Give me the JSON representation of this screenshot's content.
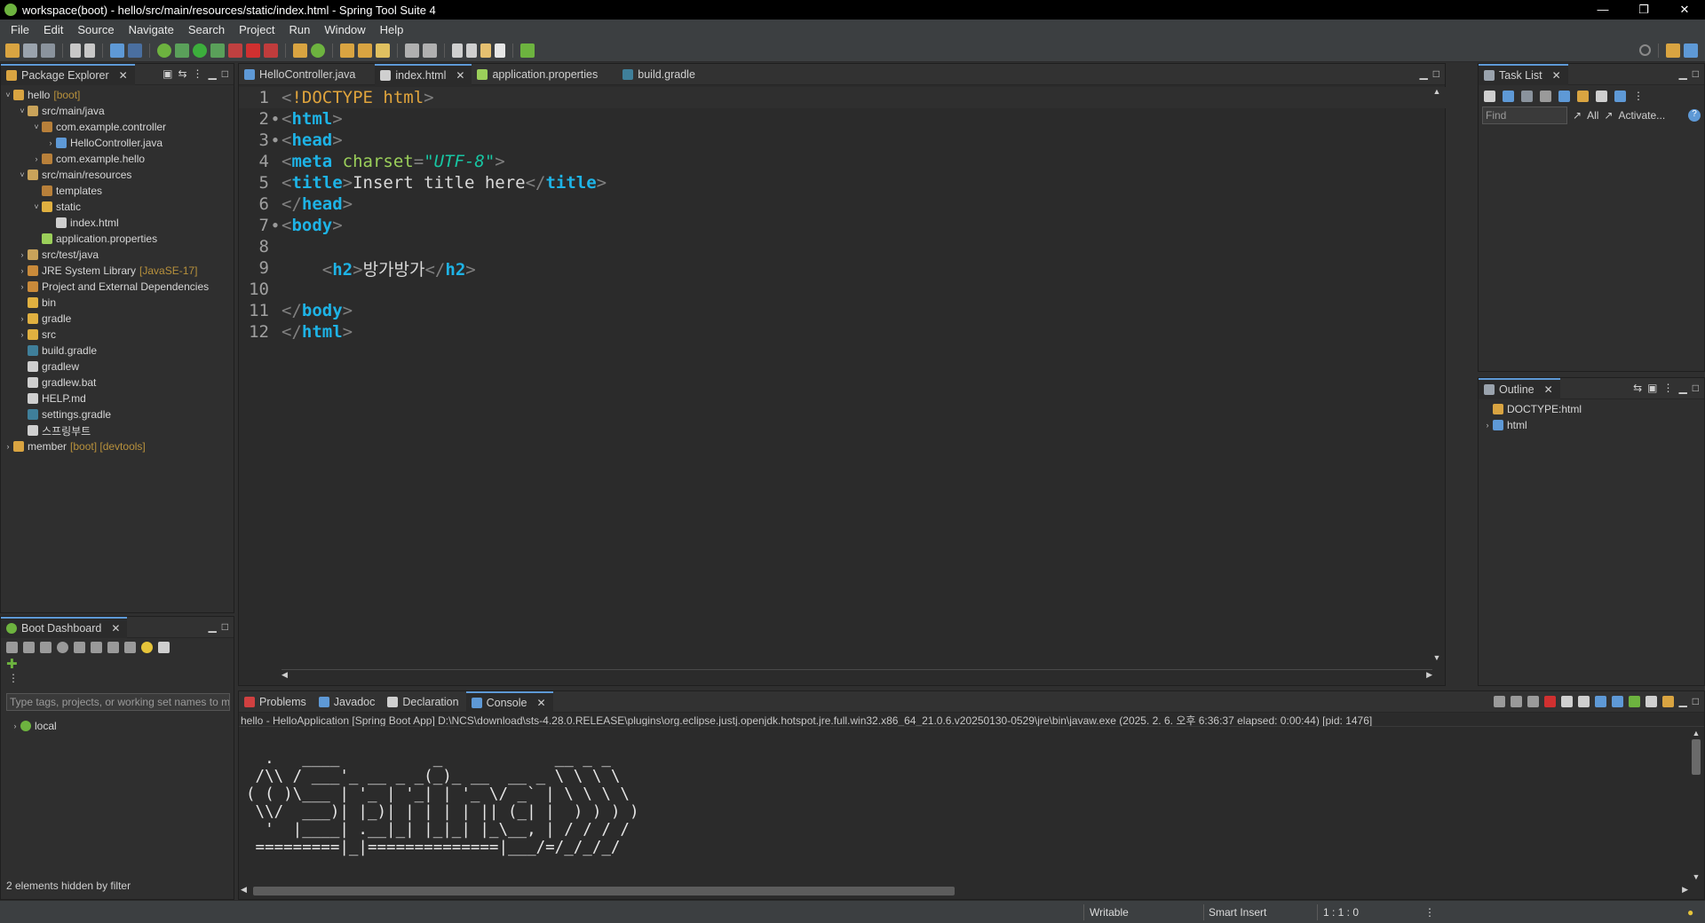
{
  "window": {
    "title": "workspace(boot) - hello/src/main/resources/static/index.html - Spring Tool Suite 4"
  },
  "menu": [
    "File",
    "Edit",
    "Source",
    "Navigate",
    "Search",
    "Project",
    "Run",
    "Window",
    "Help"
  ],
  "package_explorer": {
    "tab_label": "Package Explorer",
    "tree": [
      {
        "label": "hello",
        "deco": "[boot]",
        "arrow": "˅",
        "icon": "project-icon",
        "indent": 0
      },
      {
        "label": "src/main/java",
        "arrow": "˅",
        "icon": "source-folder-icon",
        "indent": 1
      },
      {
        "label": "com.example.controller",
        "arrow": "˅",
        "icon": "package-icon",
        "indent": 2
      },
      {
        "label": "HelloController.java",
        "arrow": "›",
        "icon": "java-file-icon",
        "indent": 3
      },
      {
        "label": "com.example.hello",
        "arrow": "›",
        "icon": "package-icon",
        "indent": 2
      },
      {
        "label": "src/main/resources",
        "arrow": "˅",
        "icon": "source-folder-icon",
        "indent": 1
      },
      {
        "label": "templates",
        "arrow": "",
        "icon": "package-icon",
        "indent": 2
      },
      {
        "label": "static",
        "arrow": "˅",
        "icon": "folder-icon",
        "indent": 2
      },
      {
        "label": "index.html",
        "arrow": "",
        "icon": "html-file-icon",
        "indent": 3
      },
      {
        "label": "application.properties",
        "arrow": "",
        "icon": "properties-file-icon",
        "indent": 2
      },
      {
        "label": "src/test/java",
        "arrow": "›",
        "icon": "source-folder-icon",
        "indent": 1
      },
      {
        "label": "JRE System Library",
        "deco": "[JavaSE-17]",
        "arrow": "›",
        "icon": "library-icon",
        "indent": 1
      },
      {
        "label": "Project and External Dependencies",
        "arrow": "›",
        "icon": "library-icon",
        "indent": 1
      },
      {
        "label": "bin",
        "arrow": "",
        "icon": "folder-icon",
        "indent": 1
      },
      {
        "label": "gradle",
        "arrow": "›",
        "icon": "folder-icon",
        "indent": 1
      },
      {
        "label": "src",
        "arrow": "›",
        "icon": "folder-icon",
        "indent": 1
      },
      {
        "label": "build.gradle",
        "arrow": "",
        "icon": "gradle-file-icon",
        "indent": 1
      },
      {
        "label": "gradlew",
        "arrow": "",
        "icon": "file-icon",
        "indent": 1
      },
      {
        "label": "gradlew.bat",
        "arrow": "",
        "icon": "file-icon",
        "indent": 1
      },
      {
        "label": "HELP.md",
        "arrow": "",
        "icon": "file-icon",
        "indent": 1
      },
      {
        "label": "settings.gradle",
        "arrow": "",
        "icon": "gradle-file-icon",
        "indent": 1
      },
      {
        "label": "스프링부트",
        "arrow": "",
        "icon": "file-icon",
        "indent": 1
      },
      {
        "label": "member",
        "deco": "[boot] [devtools]",
        "arrow": "›",
        "icon": "project-icon",
        "indent": 0
      }
    ]
  },
  "boot_dashboard": {
    "tab_label": "Boot Dashboard",
    "filter_placeholder": "Type tags, projects, or working set names to match",
    "items": [
      {
        "label": "local"
      }
    ],
    "footer": "2 elements hidden by filter"
  },
  "editor": {
    "tabs": [
      {
        "label": "HelloController.java",
        "icon": "java-file-icon",
        "active": false
      },
      {
        "label": "index.html",
        "icon": "html-file-icon",
        "active": true
      },
      {
        "label": "application.properties",
        "icon": "properties-file-icon",
        "active": false
      },
      {
        "label": "build.gradle",
        "icon": "gradle-file-icon",
        "active": false
      }
    ],
    "lines": [
      {
        "n": "1",
        "fold": "",
        "segs": [
          [
            "br",
            "<"
          ],
          [
            "doc",
            "!DOCTYPE html"
          ],
          [
            "br",
            ">"
          ]
        ]
      },
      {
        "n": "2",
        "fold": "●",
        "segs": [
          [
            "br",
            "<"
          ],
          [
            "tag",
            "html"
          ],
          [
            "br",
            ">"
          ]
        ]
      },
      {
        "n": "3",
        "fold": "●",
        "segs": [
          [
            "br",
            "<"
          ],
          [
            "tag",
            "head"
          ],
          [
            "br",
            ">"
          ]
        ]
      },
      {
        "n": "4",
        "fold": "",
        "segs": [
          [
            "br",
            "<"
          ],
          [
            "tag",
            "meta"
          ],
          [
            "txt",
            " "
          ],
          [
            "attr",
            "charset"
          ],
          [
            "br",
            "="
          ],
          [
            "val",
            "\"UTF-8\""
          ],
          [
            "br",
            ">"
          ]
        ]
      },
      {
        "n": "5",
        "fold": "",
        "segs": [
          [
            "br",
            "<"
          ],
          [
            "tag",
            "title"
          ],
          [
            "br",
            ">"
          ],
          [
            "txt",
            "Insert title here"
          ],
          [
            "br",
            "</"
          ],
          [
            "tag",
            "title"
          ],
          [
            "br",
            ">"
          ]
        ]
      },
      {
        "n": "6",
        "fold": "",
        "segs": [
          [
            "br",
            "</"
          ],
          [
            "tag",
            "head"
          ],
          [
            "br",
            ">"
          ]
        ]
      },
      {
        "n": "7",
        "fold": "●",
        "segs": [
          [
            "br",
            "<"
          ],
          [
            "tag",
            "body"
          ],
          [
            "br",
            ">"
          ]
        ]
      },
      {
        "n": "8",
        "fold": "",
        "segs": []
      },
      {
        "n": "9",
        "fold": "",
        "segs": [
          [
            "txt",
            "    "
          ],
          [
            "br",
            "<"
          ],
          [
            "tag",
            "h2"
          ],
          [
            "br",
            ">"
          ],
          [
            "txt",
            "방가방가"
          ],
          [
            "br",
            "</"
          ],
          [
            "tag",
            "h2"
          ],
          [
            "br",
            ">"
          ]
        ]
      },
      {
        "n": "10",
        "fold": "",
        "segs": []
      },
      {
        "n": "11",
        "fold": "",
        "segs": [
          [
            "br",
            "</"
          ],
          [
            "tag",
            "body"
          ],
          [
            "br",
            ">"
          ]
        ]
      },
      {
        "n": "12",
        "fold": "",
        "segs": [
          [
            "br",
            "</"
          ],
          [
            "tag",
            "html"
          ],
          [
            "br",
            ">"
          ]
        ]
      }
    ]
  },
  "task_list": {
    "tab_label": "Task List",
    "find_placeholder": "Find",
    "all_label": "All",
    "activate_label": "Activate..."
  },
  "outline": {
    "tab_label": "Outline",
    "items": [
      {
        "label": "DOCTYPE:html",
        "arrow": ""
      },
      {
        "label": "html",
        "arrow": "›"
      }
    ]
  },
  "console_panel": {
    "tabs": [
      {
        "label": "Problems",
        "active": false
      },
      {
        "label": "Javadoc",
        "active": false
      },
      {
        "label": "Declaration",
        "active": false
      },
      {
        "label": "Console",
        "active": true
      }
    ],
    "description": "hello - HelloApplication [Spring Boot App] D:\\NCS\\download\\sts-4.28.0.RELEASE\\plugins\\org.eclipse.justj.openjdk.hotspot.jre.full.win32.x86_64_21.0.6.v20250130-0529\\jre\\bin\\javaw.exe  (2025. 2. 6. 오후 6:36:37 elapsed: 0:00:44) [pid: 1476]",
    "banner": "  .   ____          _            __ _ _\n /\\\\ / ___'_ __ _ _(_)_ __  __ _ \\ \\ \\ \\\n( ( )\\___ | '_ | '_| | '_ \\/ _` | \\ \\ \\ \\\n \\\\/  ___)| |_)| | | | | || (_| |  ) ) ) )\n  '  |____| .__|_| |_|_| |_\\__, | / / / /\n =========|_|==============|___/=/_/_/_/"
  },
  "statusbar": {
    "writable": "Writable",
    "insert_mode": "Smart Insert",
    "position": "1 : 1 : 0"
  },
  "colors": {
    "accent": "#5e99d6",
    "tag": "#1eb3e6",
    "attr": "#9bcf5a",
    "value": "#17c6a3",
    "doctype": "#e0a43c",
    "spring_green": "#6db33f"
  }
}
